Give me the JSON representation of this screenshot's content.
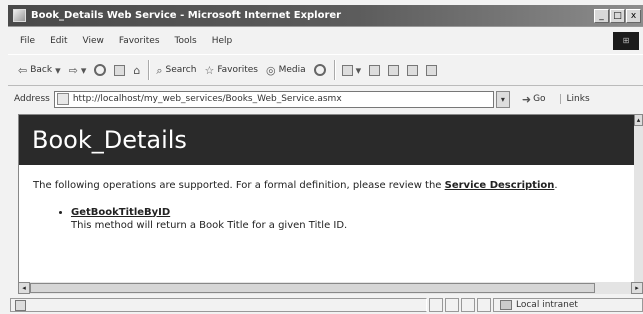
{
  "window": {
    "title": "Book_Details Web Service - Microsoft Internet Explorer",
    "buttons": {
      "minimize": "_",
      "maximize": "□",
      "close": "x"
    }
  },
  "menu": [
    "File",
    "Edit",
    "View",
    "Favorites",
    "Tools",
    "Help"
  ],
  "toolbar": {
    "back": "Back",
    "search": "Search",
    "favorites": "Favorites",
    "media": "Media"
  },
  "address": {
    "label": "Address",
    "url": "http://localhost/my_web_services/Books_Web_Service.asmx",
    "go": "Go",
    "links": "Links"
  },
  "page": {
    "heading": "Book_Details",
    "intro_text": "The following operations are supported. For a formal definition, please review the ",
    "service_description_link": "Service Description",
    "intro_end": ".",
    "operations": [
      {
        "name": "GetBookTitleByID",
        "description": "This method will return a Book Title for a given Title ID."
      }
    ]
  },
  "status": {
    "zone": "Local intranet"
  }
}
